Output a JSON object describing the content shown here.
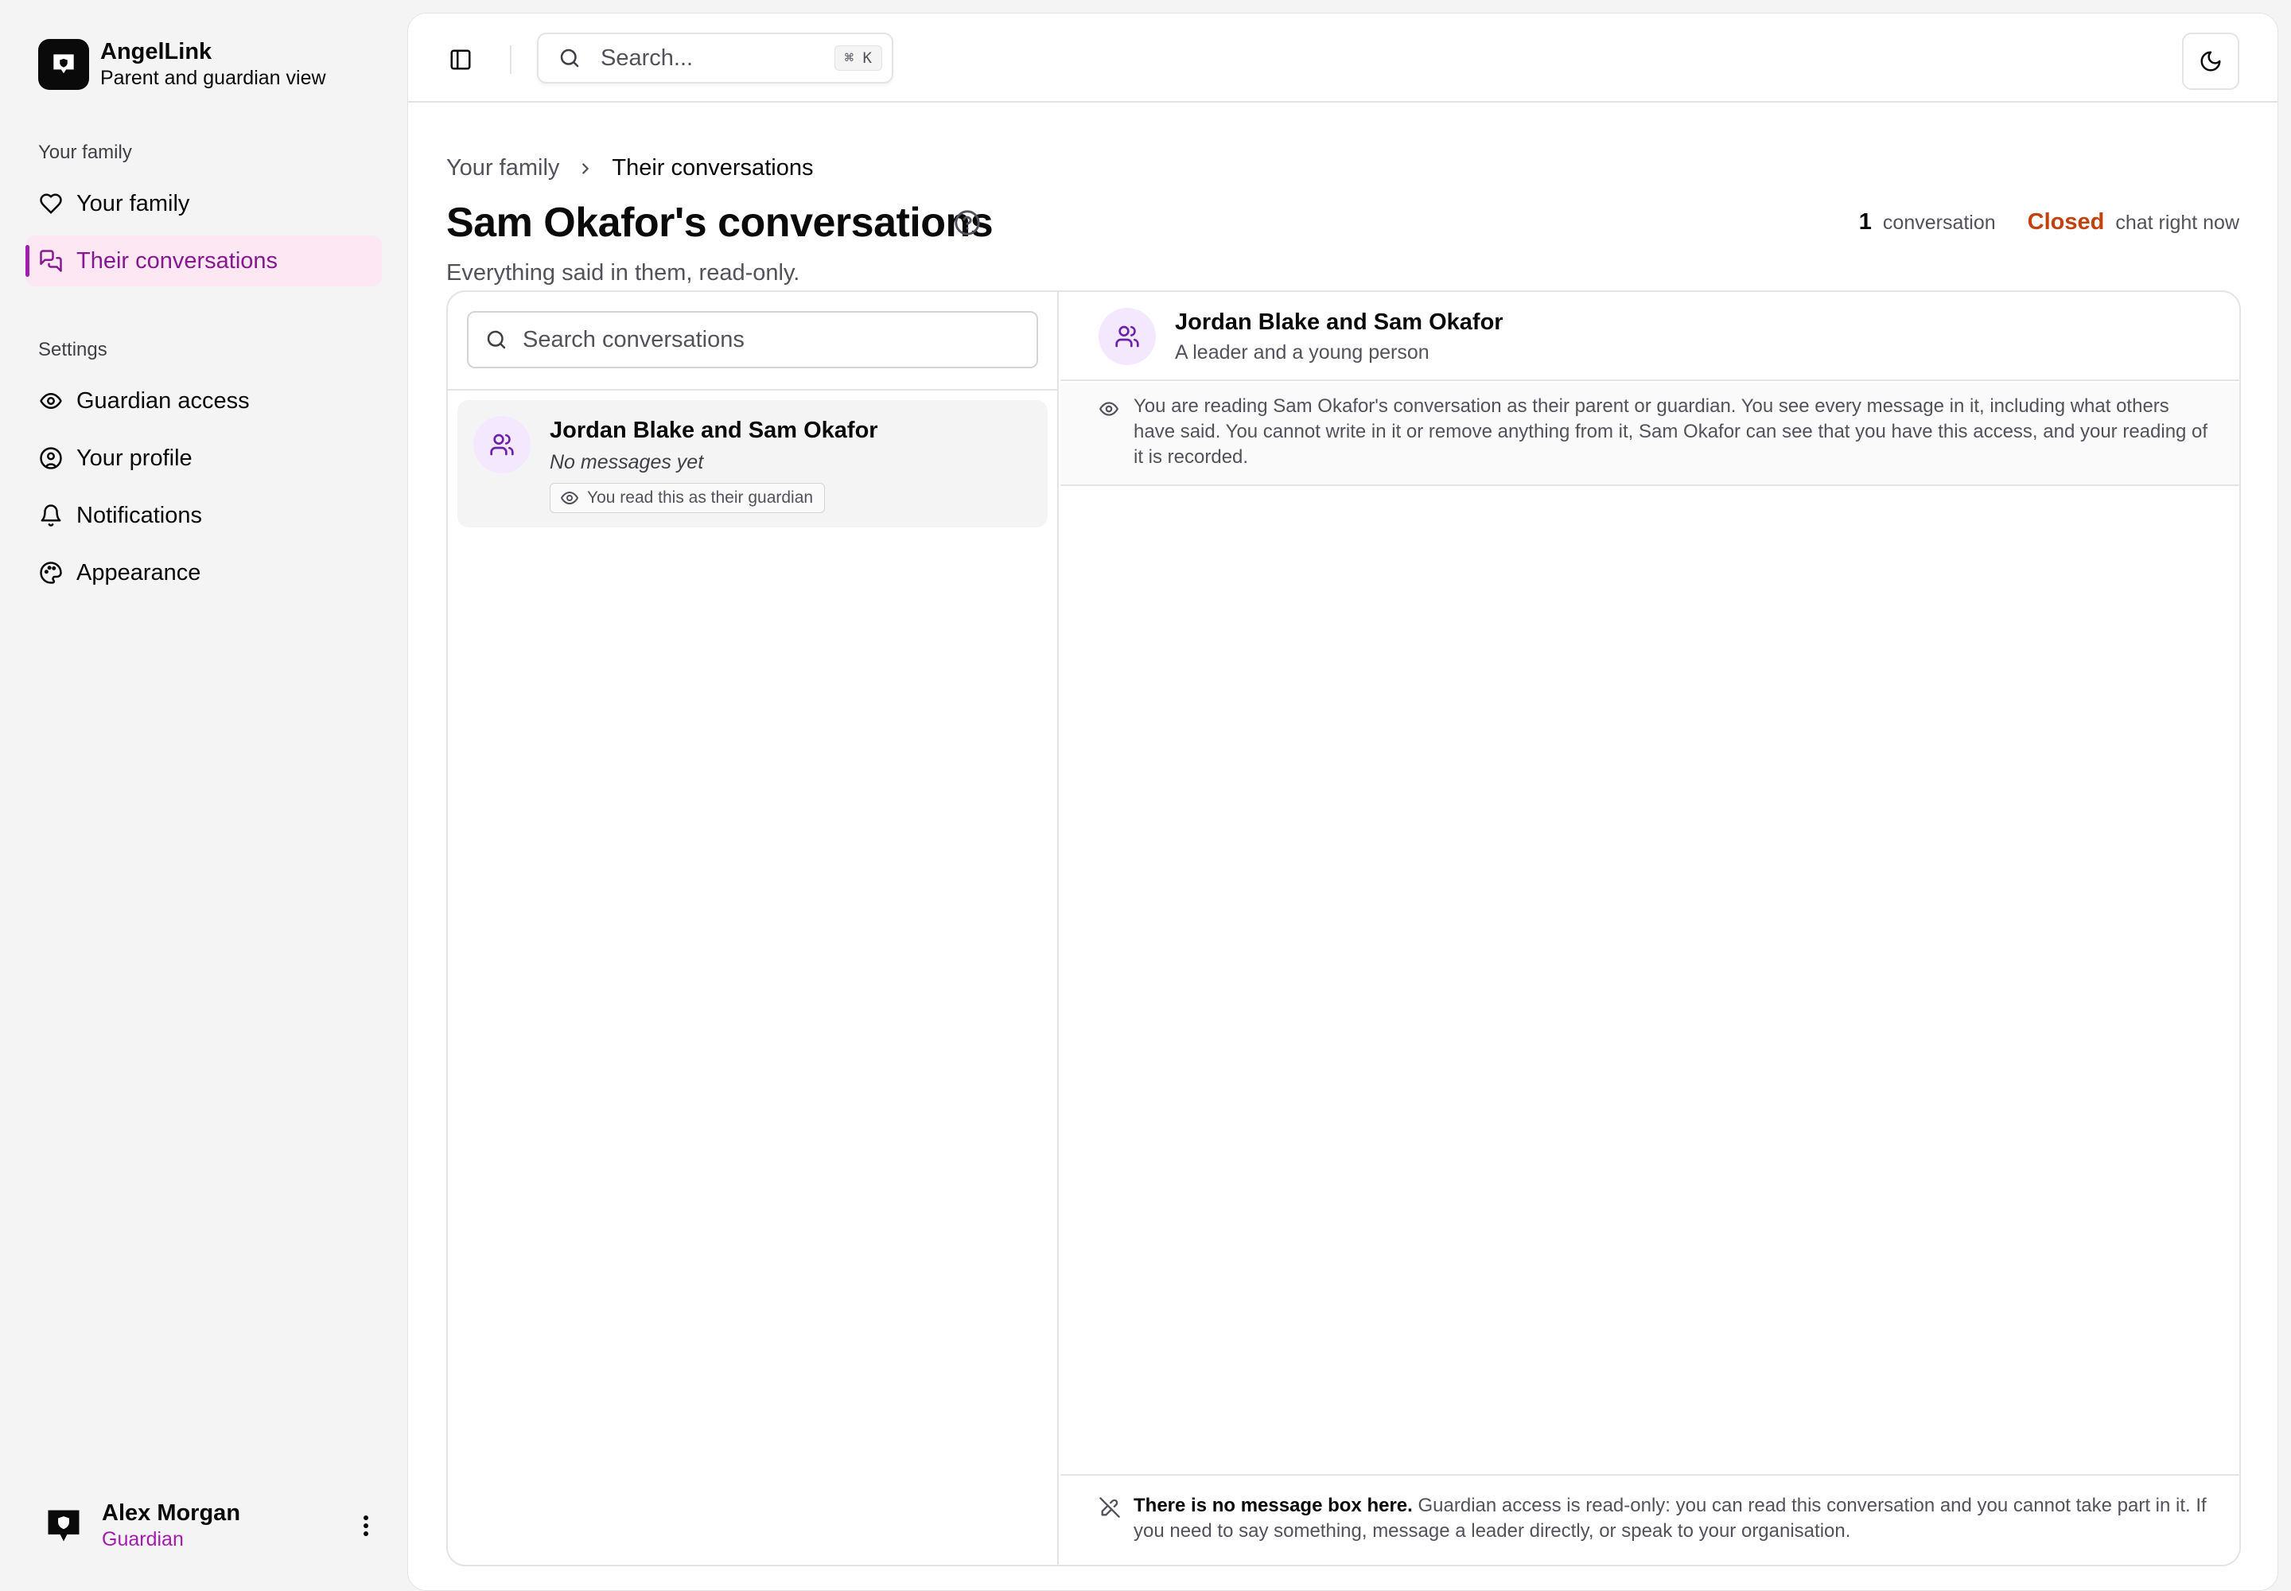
{
  "brand": {
    "name": "AngelLink",
    "subtitle": "Parent and guardian view"
  },
  "sidebar": {
    "groups": [
      {
        "label": "Your family",
        "items": [
          {
            "label": "Your family",
            "icon": "heart-icon",
            "active": false
          },
          {
            "label": "Their conversations",
            "icon": "messages-icon",
            "active": true
          }
        ]
      },
      {
        "label": "Settings",
        "items": [
          {
            "label": "Guardian access",
            "icon": "eye-icon",
            "active": false
          },
          {
            "label": "Your profile",
            "icon": "user-circle-icon",
            "active": false
          },
          {
            "label": "Notifications",
            "icon": "bell-icon",
            "active": false
          },
          {
            "label": "Appearance",
            "icon": "palette-icon",
            "active": false
          }
        ]
      }
    ],
    "user": {
      "name": "Alex Morgan",
      "role": "Guardian"
    }
  },
  "topbar": {
    "search_placeholder": "Search...",
    "shortcut": "⌘ K"
  },
  "breadcrumb": [
    "Your family",
    "Their conversations"
  ],
  "page": {
    "title": "Sam Okafor's conversations",
    "subtitle": "Everything said in them, read-only.",
    "conversation_count": "1",
    "conversation_label": "conversation",
    "chat_status": "Closed",
    "chat_status_label": "chat right now"
  },
  "list": {
    "search_placeholder": "Search conversations",
    "items": [
      {
        "title": "Jordan Blake and Sam Okafor",
        "preview": "No messages yet",
        "badge": "You read this as their guardian"
      }
    ]
  },
  "detail": {
    "title": "Jordan Blake and Sam Okafor",
    "subtitle": "A leader and a young person",
    "notice": "You are reading Sam Okafor's conversation as their parent or guardian. You see every message in it, including what others have said. You cannot write in it or remove anything from it, Sam Okafor can see that you have this access, and your reading of it is recorded.",
    "footer_strong": "There is no message box here.",
    "footer_text": "Guardian access is read-only: you can read this conversation and you cannot take part in it. If you need to say something, message a leader directly, or speak to your organisation."
  },
  "colors": {
    "accent": "#a21caf",
    "accent_bg": "#fce7f3",
    "status_closed": "#c2410c",
    "avatar_bg": "#f3e8ff"
  }
}
